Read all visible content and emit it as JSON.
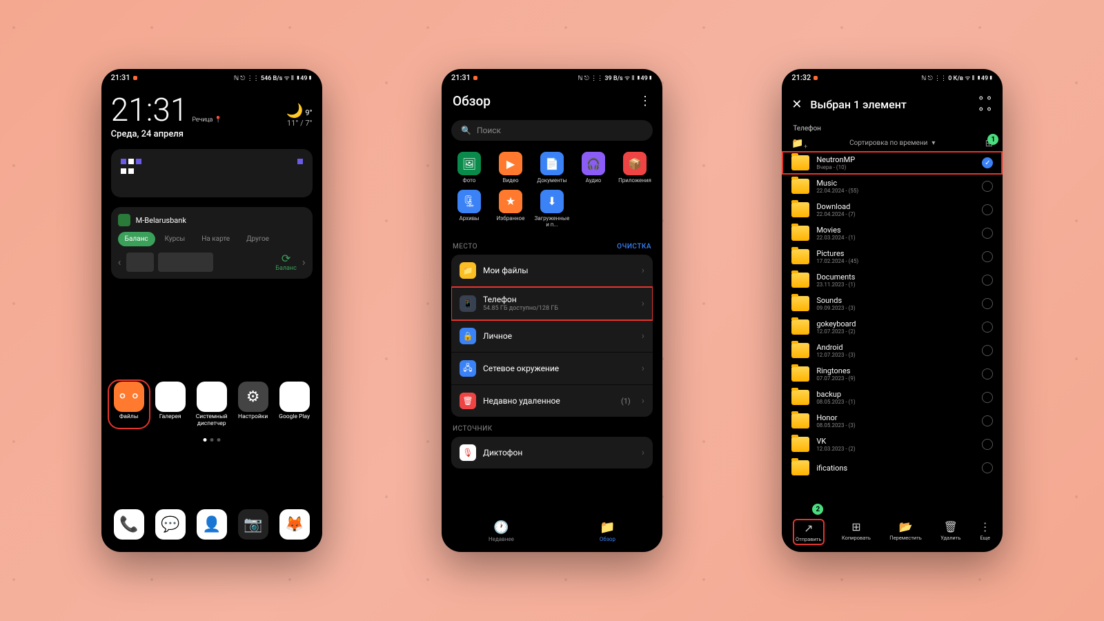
{
  "status": {
    "time1": "21:31",
    "time2": "21:31",
    "time3": "21:32",
    "icons": "ℕ ⎋ ⋮⋮ 546 B/s ᯤ ⫴ ▮49▮",
    "icons2": "ℕ ⎋ ⋮⋮ 39 B/s ᯤ ⫴ ▮49▮",
    "icons3": "ℕ ⎋ ⋮⋮ 0 К/в ᯤ ⫴ ▮49▮"
  },
  "phone1": {
    "clock": "21:31",
    "city": "Речица",
    "date": "Среда, 24 апреля",
    "weather": {
      "temp": "9°",
      "range": "11° / 7°"
    },
    "bank": {
      "name": "M-Belarusbank",
      "tabs": [
        "Баланс",
        "Курсы",
        "На карте",
        "Другое"
      ],
      "refresh": "Баланс"
    },
    "apps_top": [
      {
        "label": "Файлы",
        "bg": "#ff7a2e",
        "glyph": "⚬⚬"
      },
      {
        "label": "Галерея",
        "bg": "#fff",
        "glyph": "✿"
      },
      {
        "label": "Системный диспетчер",
        "bg": "#fff",
        "glyph": "🛡"
      },
      {
        "label": "Настройки",
        "bg": "#444",
        "glyph": "⚙"
      },
      {
        "label": "Google Play",
        "bg": "#fff",
        "glyph": "▶"
      }
    ],
    "apps_bottom": [
      {
        "bg": "#fff",
        "glyph": "📞"
      },
      {
        "bg": "#fff",
        "glyph": "💬"
      },
      {
        "bg": "#fff",
        "glyph": "👤"
      },
      {
        "bg": "#222",
        "glyph": "📷"
      },
      {
        "bg": "#fff",
        "glyph": "🦊"
      }
    ]
  },
  "phone2": {
    "title": "Обзор",
    "search": "Поиск",
    "categories": [
      {
        "label": "Фото",
        "bg": "#0a8a4a",
        "glyph": "🖼"
      },
      {
        "label": "Видео",
        "bg": "#ff7a2e",
        "glyph": "▶"
      },
      {
        "label": "Документы",
        "bg": "#3b82f6",
        "glyph": "📄"
      },
      {
        "label": "Аудио",
        "bg": "#8b5cf6",
        "glyph": "🎧"
      },
      {
        "label": "Приложения",
        "bg": "#ef4444",
        "glyph": "📦"
      },
      {
        "label": "Архивы",
        "bg": "#3b82f6",
        "glyph": "🗜"
      },
      {
        "label": "Избранное",
        "bg": "#ff7a2e",
        "glyph": "★"
      },
      {
        "label": "Загруженные и п...",
        "bg": "#3b82f6",
        "glyph": "⬇"
      }
    ],
    "place_header": "МЕСТО",
    "clean": "ОЧИСТКА",
    "places": [
      {
        "title": "Мои файлы",
        "sub": "",
        "bg": "#fbbf24",
        "glyph": "📁"
      },
      {
        "title": "Телефон",
        "sub": "54.85 ГБ доступно/128 ГБ",
        "bg": "#374151",
        "glyph": "📱",
        "hl": true
      },
      {
        "title": "Личное",
        "sub": "",
        "bg": "#3b82f6",
        "glyph": "🔒"
      },
      {
        "title": "Сетевое окружение",
        "sub": "",
        "bg": "#3b82f6",
        "glyph": "🖧"
      },
      {
        "title": "Недавно удаленное",
        "sub": "",
        "bg": "#ef4444",
        "glyph": "🗑",
        "count": "(1)"
      }
    ],
    "source_header": "ИСТОЧНИК",
    "sources": [
      {
        "title": "Диктофон",
        "bg": "#fff",
        "glyph": "🎙"
      }
    ],
    "nav": [
      {
        "label": "Недавнее",
        "glyph": "🕐"
      },
      {
        "label": "Обзор",
        "glyph": "📁",
        "active": true
      }
    ]
  },
  "phone3": {
    "title": "Выбран 1 элемент",
    "crumb": "Телефон",
    "sort": "Сортировка по времени",
    "folders": [
      {
        "name": "NeutronMP",
        "meta": "Вчера - (10)",
        "checked": true,
        "hl": true
      },
      {
        "name": "Music",
        "meta": "22.04.2024 - (55)"
      },
      {
        "name": "Download",
        "meta": "22.04.2024 - (7)"
      },
      {
        "name": "Movies",
        "meta": "22.03.2024 - (1)"
      },
      {
        "name": "Pictures",
        "meta": "17.02.2024 - (45)"
      },
      {
        "name": "Documents",
        "meta": "23.11.2023 - (1)"
      },
      {
        "name": "Sounds",
        "meta": "09.09.2023 - (3)"
      },
      {
        "name": "gokeyboard",
        "meta": "12.07.2023 - (2)"
      },
      {
        "name": "Android",
        "meta": "12.07.2023 - (3)"
      },
      {
        "name": "Ringtones",
        "meta": "07.07.2023 - (9)"
      },
      {
        "name": "backup",
        "meta": "08.05.2023 - (1)"
      },
      {
        "name": "Honor",
        "meta": "08.05.2023 - (3)"
      },
      {
        "name": "VK",
        "meta": "12.03.2023 - (2)"
      },
      {
        "name": "ifications",
        "meta": ""
      }
    ],
    "actions": [
      {
        "label": "Отправить",
        "glyph": "↗",
        "hl": true
      },
      {
        "label": "Копировать",
        "glyph": "⊞"
      },
      {
        "label": "Переместить",
        "glyph": "📂"
      },
      {
        "label": "Удалить",
        "glyph": "🗑"
      },
      {
        "label": "Еще",
        "glyph": "⋮"
      }
    ],
    "badges": {
      "b1": "1",
      "b2": "2"
    }
  }
}
